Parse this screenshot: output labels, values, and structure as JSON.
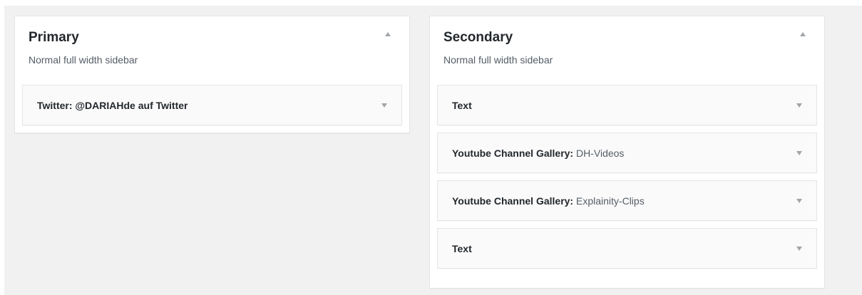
{
  "sidebars": {
    "primary": {
      "title": "Primary",
      "description": "Normal full width sidebar",
      "widgets": [
        {
          "name": "Twitter:",
          "subtitle": "@DARIAHde auf Twitter"
        }
      ]
    },
    "secondary": {
      "title": "Secondary",
      "description": "Normal full width sidebar",
      "widgets": [
        {
          "name": "Text",
          "subtitle": ""
        },
        {
          "name": "Youtube Channel Gallery:",
          "subtitle": "DH-Videos"
        },
        {
          "name": "Youtube Channel Gallery:",
          "subtitle": "Explainity-Clips"
        },
        {
          "name": "Text",
          "subtitle": ""
        }
      ]
    }
  },
  "icons": {
    "collapse": "triangle-up-icon",
    "expand": "triangle-down-icon"
  },
  "colors": {
    "background": "#f1f1f1",
    "panel": "#ffffff",
    "widget": "#fafafa",
    "border": "#e5e5e5",
    "text": "#23282d",
    "muted": "#555d66",
    "arrow": "#a0a5aa"
  }
}
